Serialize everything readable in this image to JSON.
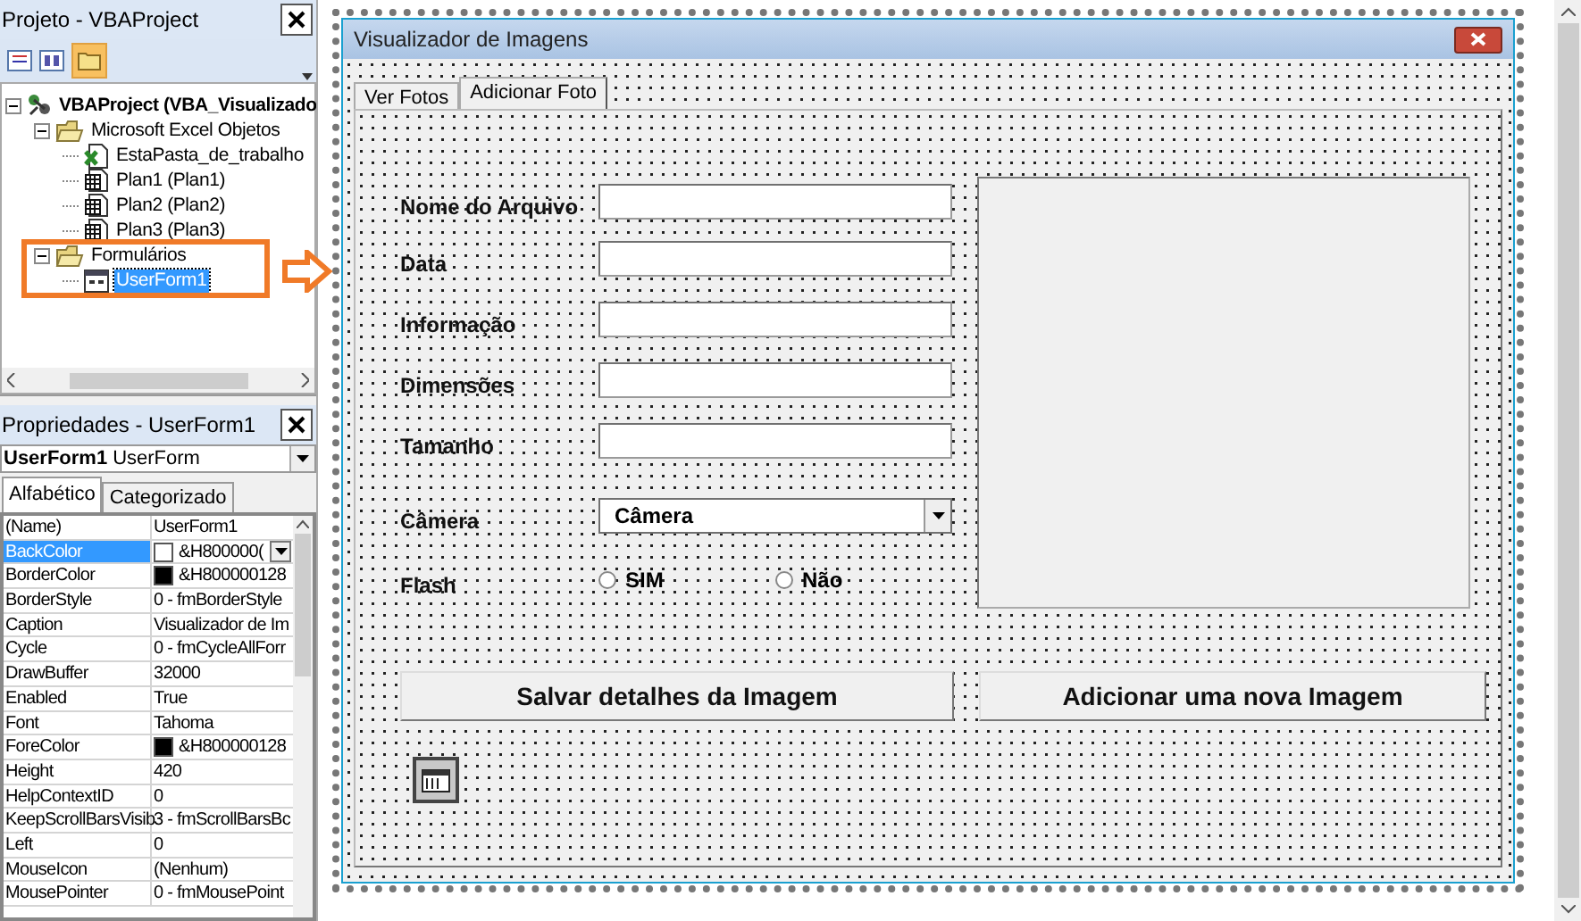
{
  "project": {
    "title": "Projeto - VBAProject",
    "tree": [
      {
        "label": "VBAProject (VBA_Visualizado",
        "kind": "project",
        "expanded": true,
        "selected": false,
        "children": [
          {
            "label": "Microsoft Excel Objetos",
            "kind": "folder",
            "expanded": true,
            "selected": false,
            "children": [
              {
                "label": "EstaPasta_de_trabalho",
                "kind": "workbook",
                "selected": false
              },
              {
                "label": "Plan1 (Plan1)",
                "kind": "sheet",
                "selected": false
              },
              {
                "label": "Plan2 (Plan2)",
                "kind": "sheet",
                "selected": false
              },
              {
                "label": "Plan3 (Plan3)",
                "kind": "sheet",
                "selected": false
              }
            ]
          },
          {
            "label": "Formulários",
            "kind": "folder",
            "expanded": true,
            "selected": false,
            "children": [
              {
                "label": "UserForm1",
                "kind": "form",
                "selected": true
              }
            ]
          }
        ]
      }
    ]
  },
  "properties": {
    "title": "Propriedades - UserForm1",
    "object_name": "UserForm1",
    "object_type": "UserForm",
    "tabs": [
      {
        "label": "Alfabético",
        "selected": true
      },
      {
        "label": "Categorizado",
        "selected": false
      }
    ],
    "rows": [
      {
        "name": "(Name)",
        "value": "UserForm1",
        "kind": "text",
        "selected": false
      },
      {
        "name": "BackColor",
        "value": "&H800000(",
        "kind": "color_dropdown",
        "color": "#ffffff",
        "selected": true
      },
      {
        "name": "BorderColor",
        "value": "&H800000128",
        "kind": "color",
        "color": "#000000",
        "selected": false
      },
      {
        "name": "BorderStyle",
        "value": "0 - fmBorderStyle",
        "kind": "text",
        "selected": false
      },
      {
        "name": "Caption",
        "value": "Visualizador de Im",
        "kind": "text",
        "selected": false
      },
      {
        "name": "Cycle",
        "value": "0 - fmCycleAllForr",
        "kind": "text",
        "selected": false
      },
      {
        "name": "DrawBuffer",
        "value": "32000",
        "kind": "text",
        "selected": false
      },
      {
        "name": "Enabled",
        "value": "True",
        "kind": "text",
        "selected": false
      },
      {
        "name": "Font",
        "value": "Tahoma",
        "kind": "text",
        "selected": false
      },
      {
        "name": "ForeColor",
        "value": "&H800000128",
        "kind": "color",
        "color": "#000000",
        "selected": false
      },
      {
        "name": "Height",
        "value": "420",
        "kind": "text",
        "selected": false
      },
      {
        "name": "HelpContextID",
        "value": "0",
        "kind": "text",
        "selected": false
      },
      {
        "name": "KeepScrollBarsVisib",
        "value": "3 - fmScrollBarsBc",
        "kind": "text",
        "selected": false
      },
      {
        "name": "Left",
        "value": "0",
        "kind": "text",
        "selected": false
      },
      {
        "name": "MouseIcon",
        "value": "(Nenhum)",
        "kind": "text",
        "selected": false
      },
      {
        "name": "MousePointer",
        "value": "0 - fmMousePoint",
        "kind": "text",
        "selected": false
      }
    ]
  },
  "form": {
    "title": "Visualizador de Imagens",
    "tabs": [
      {
        "label": "Ver Fotos",
        "selected": false
      },
      {
        "label": "Adicionar Foto",
        "selected": true
      }
    ],
    "fields": [
      {
        "label": "Nome do Arquivo",
        "kind": "text"
      },
      {
        "label": "Data",
        "kind": "text"
      },
      {
        "label": "Informação",
        "kind": "text"
      },
      {
        "label": "Dimensões",
        "kind": "text"
      },
      {
        "label": "Tamanho",
        "kind": "text"
      },
      {
        "label": "Câmera",
        "kind": "combo",
        "value": "Câmera"
      },
      {
        "label": "Flash",
        "kind": "radio",
        "options": [
          {
            "label": "SIM",
            "selected": false
          },
          {
            "label": "Não",
            "selected": false
          }
        ]
      }
    ],
    "buttons": [
      "Salvar detalhes da Imagem",
      "Adicionar uma nova Imagem"
    ]
  }
}
